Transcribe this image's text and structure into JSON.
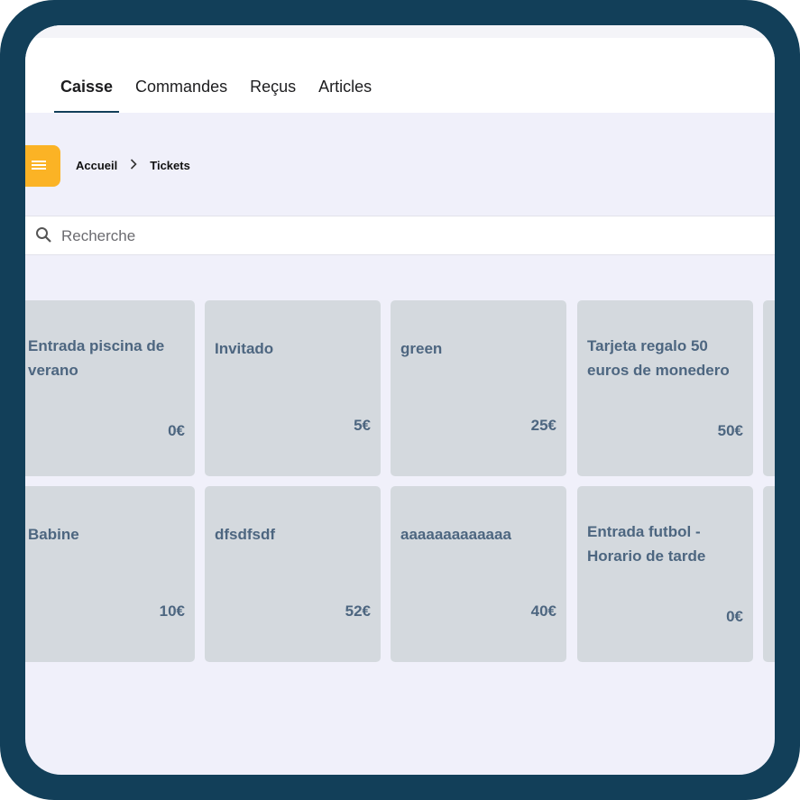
{
  "tabs": [
    {
      "label": "Caisse",
      "active": true
    },
    {
      "label": "Commandes",
      "active": false
    },
    {
      "label": "Reçus",
      "active": false
    },
    {
      "label": "Articles",
      "active": false
    }
  ],
  "menu_button": {
    "icon": "hamburger-icon",
    "color": "#fbb325"
  },
  "breadcrumb": {
    "items": [
      "Accueil",
      "Tickets"
    ],
    "separator_icon": "chevron-right-icon"
  },
  "search": {
    "placeholder": "Recherche",
    "value": "",
    "icon": "search-icon"
  },
  "tickets": [
    {
      "name": "Entrada piscina de verano",
      "price": "0€"
    },
    {
      "name": "Invitado",
      "price": "5€"
    },
    {
      "name": "green",
      "price": "25€"
    },
    {
      "name": "Tarjeta regalo 50 euros de monedero",
      "price": "50€"
    },
    {
      "name": "",
      "price": ""
    },
    {
      "name": "Babine",
      "price": "10€"
    },
    {
      "name": "dfsdfsdf",
      "price": "52€"
    },
    {
      "name": "aaaaaaaaaaaaa",
      "price": "40€"
    },
    {
      "name": "Entrada futbol - Horario de tarde",
      "price": "0€"
    },
    {
      "name": "",
      "price": ""
    }
  ],
  "colors": {
    "frame": "#123f59",
    "background": "#f0f0fa",
    "card": "#d4d9de",
    "card_text": "#4d6680",
    "accent": "#fbb325"
  }
}
